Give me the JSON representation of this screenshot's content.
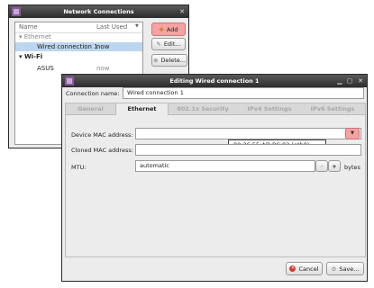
{
  "network_window": {
    "title": "Network Connections",
    "columns": {
      "name": "Name",
      "last_used": "Last Used"
    },
    "sections": [
      {
        "header": "Ethernet",
        "items": [
          {
            "name": "Wired connection 1",
            "last_used": "now",
            "selected": true
          }
        ]
      },
      {
        "header": "Wi-Fi",
        "items": [
          {
            "name": "ASUS",
            "last_used": "now",
            "selected": false
          }
        ]
      }
    ],
    "buttons": {
      "add": "Add",
      "edit": "Edit...",
      "delete": "Delete..."
    }
  },
  "edit_dialog": {
    "title": "Editing Wired connection 1",
    "connection_name_label": "Connection name:",
    "connection_name_value": "Wired connection 1",
    "tabs": [
      "General",
      "Ethernet",
      "802.1x Security",
      "IPv4 Settings",
      "IPv6 Settings"
    ],
    "active_tab": "Ethernet",
    "device_mac_label": "Device MAC address:",
    "device_mac_value": "",
    "dropdown_option": "00:26:55:AD:BC:92 (eth0)",
    "cloned_mac_label": "Cloned MAC address:",
    "cloned_mac_value": "",
    "mtu_label": "MTU:",
    "mtu_value": "automatic",
    "mtu_unit": "bytes",
    "minus": "−",
    "plus": "+",
    "cancel": "Cancel",
    "save": "Save..."
  },
  "colors": {
    "highlight": "#f4a2a2",
    "selection": "#bcd6ef",
    "titlebar": "#3a3a3a"
  }
}
